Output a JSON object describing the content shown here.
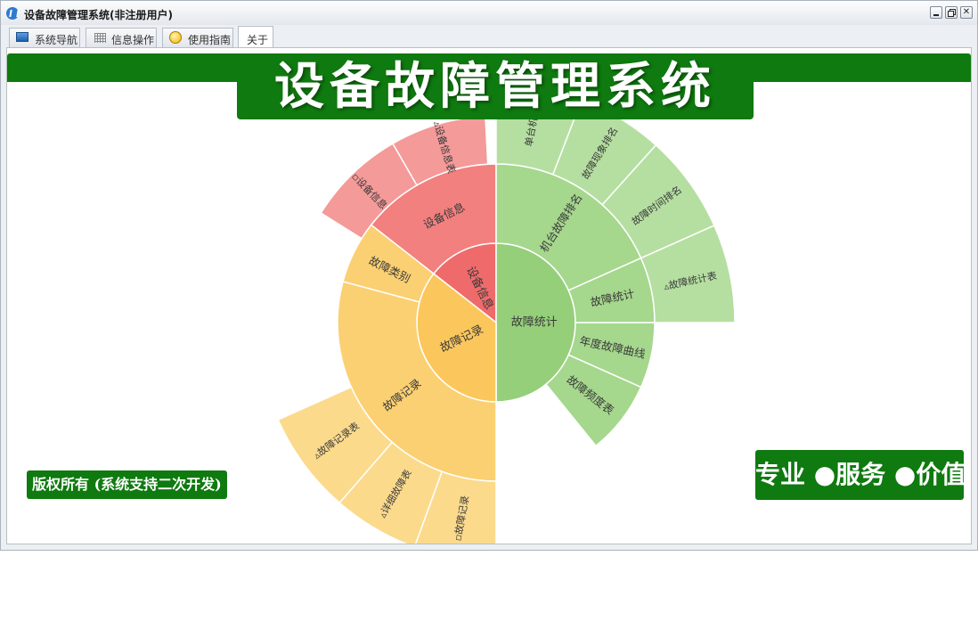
{
  "window": {
    "title": "设备故障管理系统(非注册用户)"
  },
  "tabs": [
    {
      "label": "系统导航",
      "icon": "monitor-icon"
    },
    {
      "label": "信息操作",
      "icon": "grid-icon"
    },
    {
      "label": "使用指南",
      "icon": "smiley-icon"
    },
    {
      "label": "关于"
    }
  ],
  "main": {
    "title": "设备故障管理系统",
    "copyright": "版权所有 (系统支持二次开发)",
    "slogan": "专业 ●服务 ●价值"
  },
  "colors": {
    "brand_green": "#0f7a0f",
    "red": "#ef6b6b",
    "orange": "#fbc75c",
    "green": "#95cf7a"
  },
  "chart_data": {
    "type": "sunburst",
    "nodes": [
      {
        "label": "设备信息",
        "color": "#ef6b6b",
        "children": [
          {
            "label": "设备信息",
            "children": [
              {
                "label": "▫设备信息"
              },
              {
                "label": "▵设备信息表"
              }
            ]
          }
        ]
      },
      {
        "label": "故障统计",
        "color": "#95cf7a",
        "children": [
          {
            "label": "故障频度表"
          },
          {
            "label": "年度故障曲线"
          },
          {
            "label": "故障统计",
            "children": [
              {
                "label": "▵故障统计表"
              }
            ]
          },
          {
            "label": "机台故障排名",
            "children": [
              {
                "label": "故障时间排名"
              },
              {
                "label": "故障现象排名"
              },
              {
                "label": "单台机历"
              }
            ]
          }
        ]
      },
      {
        "label": "故障记录",
        "color": "#fbc75c",
        "children": [
          {
            "label": "故障记录",
            "children": [
              {
                "label": "▫故障记录"
              },
              {
                "label": "▵详细故障表"
              },
              {
                "label": "▵故障记录表"
              }
            ]
          },
          {
            "label": "故障类别"
          }
        ]
      }
    ]
  }
}
